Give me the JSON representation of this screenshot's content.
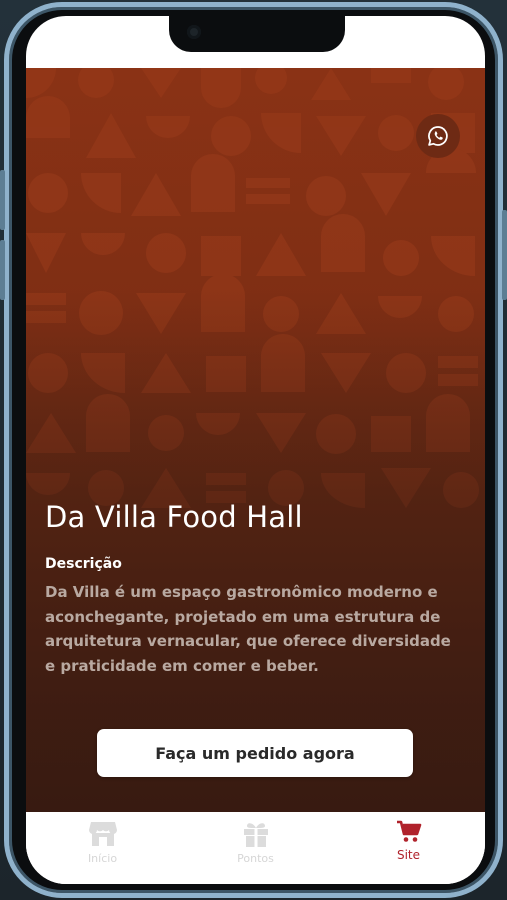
{
  "app": {
    "title": "Da Villa Food Hall",
    "description_label": "Descrição",
    "description": "Da Villa é um espaço gastronômico moderno e aconchegante, projetado em uma estrutura de arquitetura vernacular, que oferece diversidade e praticidade em comer e beber.",
    "cta_label": "Faça um pedido agora",
    "whatsapp_icon": "whatsapp-icon"
  },
  "tabs": [
    {
      "label": "Início",
      "icon": "store-icon",
      "active": false
    },
    {
      "label": "Pontos",
      "icon": "gift-icon",
      "active": false
    },
    {
      "label": "Site",
      "icon": "cart-icon",
      "active": true
    }
  ],
  "colors": {
    "hero_top": "#8a3215",
    "hero_bottom": "#3e1d12",
    "active_tab": "#b0222b",
    "inactive_tab": "#d6d6d6",
    "frame": "#8fb2cc"
  }
}
